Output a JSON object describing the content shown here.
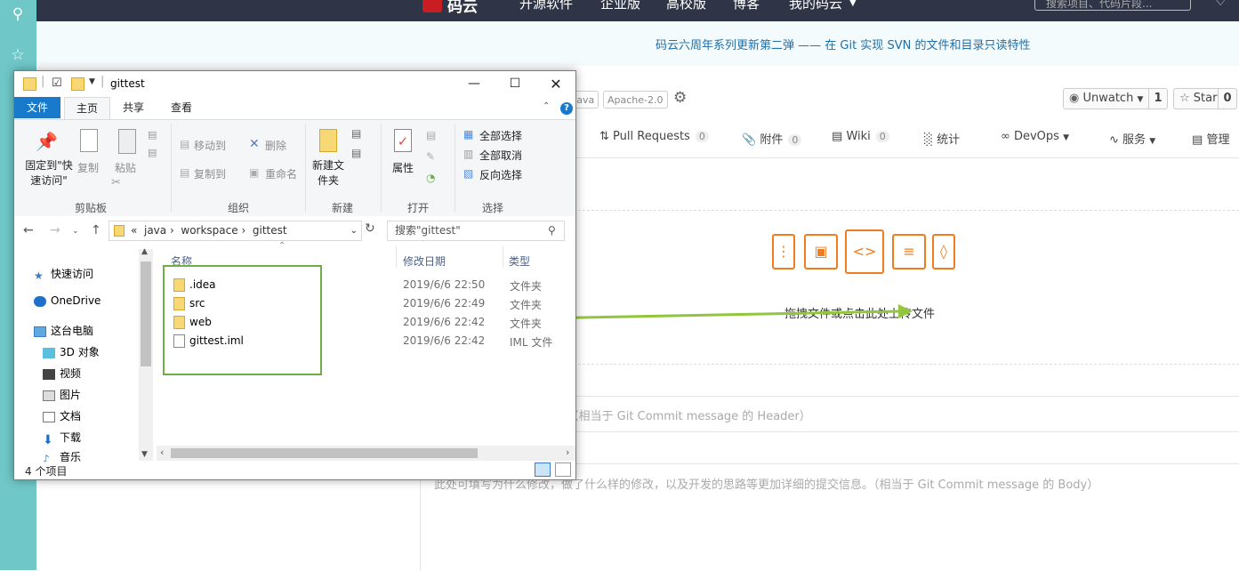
{
  "topnav": {
    "logo_text": "码云",
    "items": [
      "开源软件",
      "企业版",
      "高校版",
      "博客",
      "我的码云"
    ],
    "search_placeholder": "搜索项目、代码片段..."
  },
  "banner": {
    "text": "码云六周年系列更新第二弹 —— 在 Git 实现 SVN 的文件和目录只读特性"
  },
  "repo": {
    "tags": [
      "Java",
      "Apache-2.0"
    ],
    "unwatch_label": "Unwatch",
    "unwatch_count": "1",
    "star_label": "Star",
    "star_count": "0",
    "tabs": [
      {
        "label": "Pull Requests",
        "count": "0"
      },
      {
        "label": "附件",
        "count": "0"
      },
      {
        "label": "Wiki",
        "count": "0"
      },
      {
        "label": "统计"
      },
      {
        "label": "DevOps"
      },
      {
        "label": "服务"
      },
      {
        "label": "管理"
      }
    ]
  },
  "upload": {
    "text": "拖拽文件或点击此处上传文件"
  },
  "form": {
    "commit_header_placeholder": "扼要描述本次提交的内容。（相当于 Git Commit message 的 Header）",
    "commit_body_placeholder": "此处可填写为什么修改，做了什么样的修改，以及开发的思路等更加详细的提交信息。（相当于 Git Commit message 的 Body）"
  },
  "explorer": {
    "title": "gittest",
    "ribbon_tabs": [
      "文件",
      "主页",
      "共享",
      "查看"
    ],
    "ribbon": {
      "pin": "固定到\"快速访问\"",
      "copy": "复制",
      "paste": "粘贴",
      "move_to": "移动到",
      "copy_to": "复制到",
      "delete": "删除",
      "rename": "重命名",
      "new_folder": "新建文件夹",
      "properties": "属性",
      "select_all": "全部选择",
      "select_none": "全部取消",
      "invert_selection": "反向选择",
      "groups": [
        "剪贴板",
        "组织",
        "新建",
        "打开",
        "选择"
      ]
    },
    "breadcrumb": [
      "java",
      "workspace",
      "gittest"
    ],
    "search_placeholder": "搜索\"gittest\"",
    "nav_items": [
      "快速访问",
      "OneDrive",
      "这台电脑",
      "3D 对象",
      "视频",
      "图片",
      "文档",
      "下载",
      "音乐"
    ],
    "columns": [
      "名称",
      "修改日期",
      "类型"
    ],
    "files": [
      {
        "name": ".idea",
        "date": "2019/6/6 22:50",
        "type": "文件夹",
        "icon": "folder-icon"
      },
      {
        "name": "src",
        "date": "2019/6/6 22:49",
        "type": "文件夹",
        "icon": "folder-icon"
      },
      {
        "name": "web",
        "date": "2019/6/6 22:42",
        "type": "文件夹",
        "icon": "folder-icon"
      },
      {
        "name": "gittest.iml",
        "date": "2019/6/6 22:42",
        "type": "IML 文件",
        "icon": "file-icon"
      }
    ],
    "status": "4 个项目"
  },
  "colors": {
    "teal": "#70c7c8",
    "nav_bg": "#2f3546",
    "brand_red": "#c71d23",
    "accent_orange": "#f07c1f",
    "arrow_green": "#92c63f",
    "explorer_blue": "#1979ca"
  }
}
